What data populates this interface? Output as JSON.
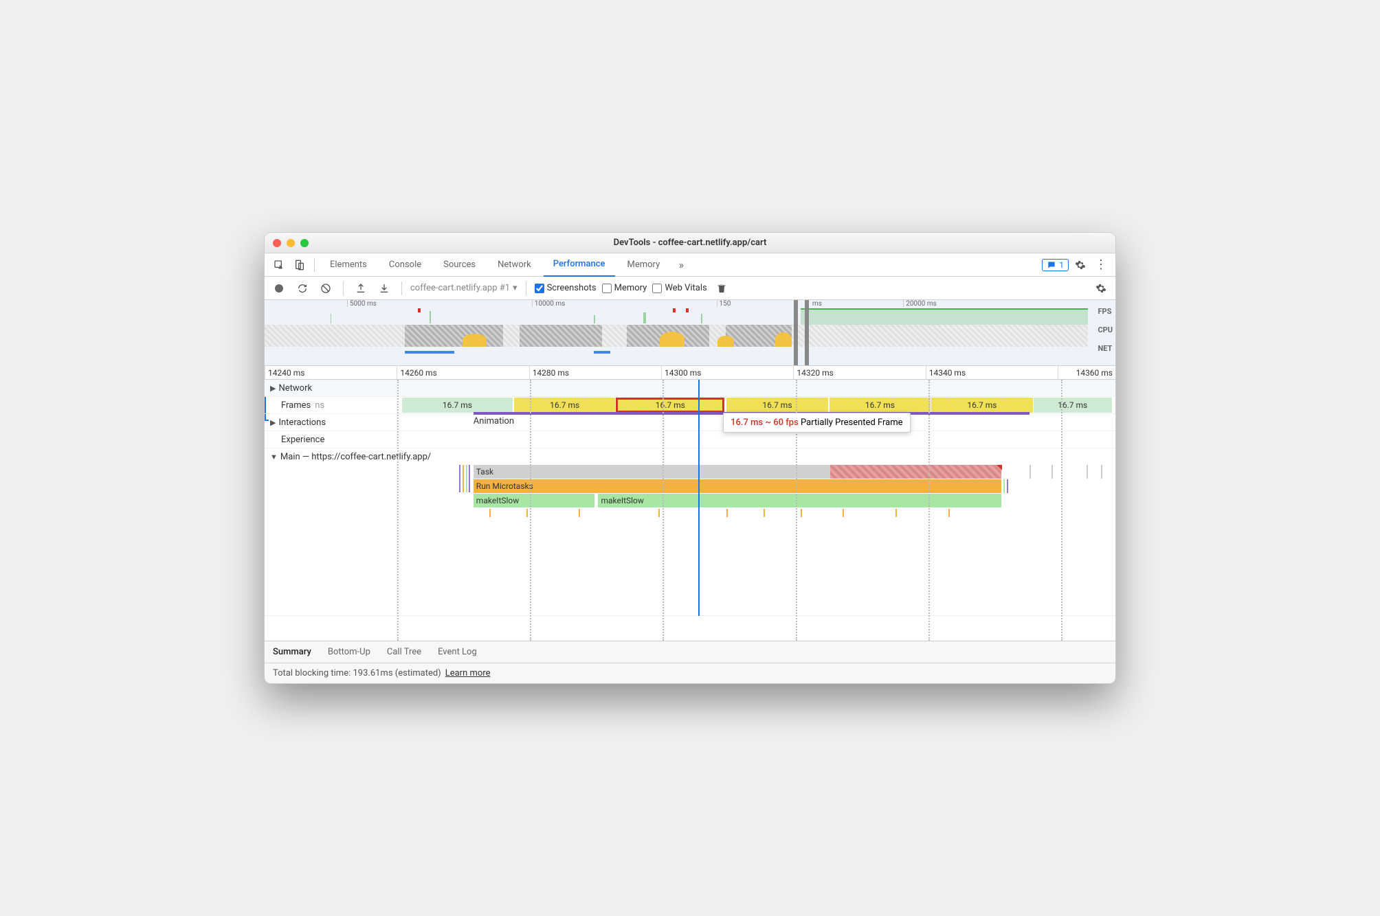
{
  "window": {
    "title": "DevTools - coffee-cart.netlify.app/cart"
  },
  "tabs": [
    "Elements",
    "Console",
    "Sources",
    "Network",
    "Performance",
    "Memory"
  ],
  "activeTab": "Performance",
  "issuesCount": "1",
  "toolbar": {
    "recordingName": "coffee-cart.netlify.app #1",
    "cbScreenshots": "Screenshots",
    "cbMemory": "Memory",
    "cbWebVitals": "Web Vitals"
  },
  "overview": {
    "ticks": [
      "5000 ms",
      "10000 ms",
      "150",
      "ms",
      "20000 ms"
    ],
    "labels": [
      "FPS",
      "CPU",
      "NET"
    ]
  },
  "ruler": [
    "14240 ms",
    "14260 ms",
    "14280 ms",
    "14300 ms",
    "14320 ms",
    "14340 ms",
    "14360 ms"
  ],
  "tracks": {
    "network": "Network",
    "frames": "Frames",
    "framesSuffix": "ns",
    "interactions": "Interactions",
    "animation": "Animation",
    "experience": "Experience",
    "main": "Main — https://coffee-cart.netlify.app/"
  },
  "frameLabels": [
    "16.7 ms",
    "16.7 ms",
    "16.7 ms",
    "16.7 ms",
    "16.7 ms",
    "16.7 ms",
    "16.7 ms"
  ],
  "tooltip": {
    "time": "16.7 ms ~ 60 fps",
    "desc": "Partially Presented Frame"
  },
  "flame": {
    "task": "Task",
    "microtasks": "Run Microtasks",
    "fn1": "makeItSlow",
    "fn2": "makeItSlow"
  },
  "bottomTabs": [
    "Summary",
    "Bottom-Up",
    "Call Tree",
    "Event Log"
  ],
  "activeBottomTab": "Summary",
  "status": {
    "text": "Total blocking time: 193.61ms (estimated)",
    "link": "Learn more"
  }
}
